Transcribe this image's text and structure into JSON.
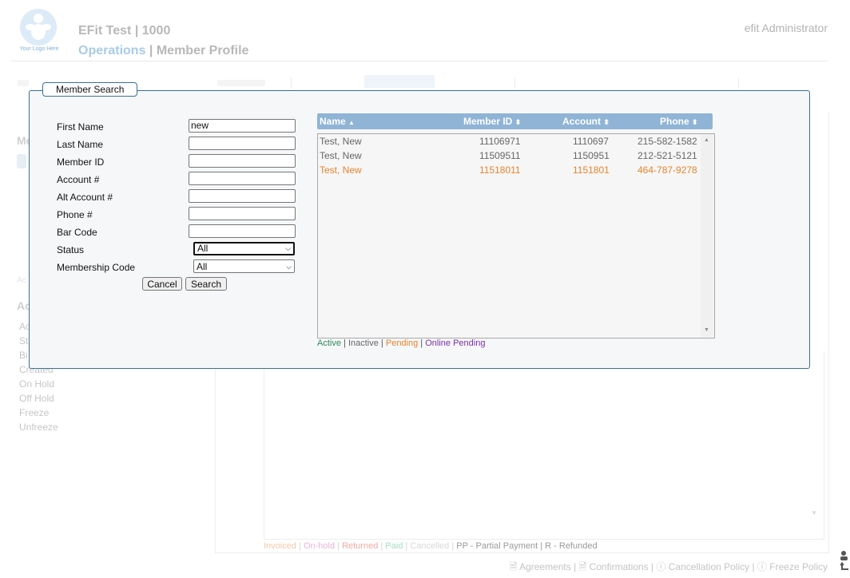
{
  "header": {
    "logo_text": "Your Logo Here",
    "company": "EFit Test | 1000",
    "crumb_section": "Operations",
    "crumb_sep": " | ",
    "crumb_page": "Member Profile",
    "user": "efit Administrator"
  },
  "background": {
    "member_heading": "Me",
    "account_small": "Ac",
    "account_heading": "Ac",
    "side_items": [
      "Ac",
      "St",
      "Bi",
      "Created",
      "On Hold",
      "Off Hold",
      "Freeze",
      "Unfreeze"
    ],
    "billing_legend": [
      {
        "text": "Invoiced",
        "color": "#f5c9a8"
      },
      {
        "text": "On-hold",
        "color": "#e8b3d9"
      },
      {
        "text": "Returned",
        "color": "#f2a9a0"
      },
      {
        "text": "Paid",
        "color": "#a8dcc0"
      },
      {
        "text": "Cancelled",
        "color": "#d8d8d8"
      },
      {
        "text": "PP - Partial Payment",
        "color": "#9a9a9a"
      },
      {
        "text": "R - Refunded",
        "color": "#9a9a9a"
      }
    ],
    "footer_links": [
      "Agreements",
      "Confirmations",
      "Cancellation Policy",
      "Freeze Policy"
    ]
  },
  "modal": {
    "title": "Member Search",
    "fields": {
      "first_name": {
        "label": "First Name",
        "value": "new"
      },
      "last_name": {
        "label": "Last Name",
        "value": ""
      },
      "member_id": {
        "label": "Member ID",
        "value": ""
      },
      "account": {
        "label": "Account #",
        "value": ""
      },
      "alt_account": {
        "label": "Alt Account #",
        "value": ""
      },
      "phone": {
        "label": "Phone #",
        "value": ""
      },
      "bar_code": {
        "label": "Bar Code",
        "value": ""
      },
      "status": {
        "label": "Status",
        "value": "All"
      },
      "membership_code": {
        "label": "Membership Code",
        "value": "All"
      }
    },
    "cancel_label": "Cancel",
    "search_label": "Search",
    "results": {
      "columns": [
        "Name",
        "Member ID",
        "Account",
        "Phone"
      ],
      "rows": [
        {
          "name": "Test, New",
          "member_id": "11106971",
          "account": "1110697",
          "phone": "215-582-1582",
          "status": "inactive"
        },
        {
          "name": "Test, New",
          "member_id": "11509511",
          "account": "1150951",
          "phone": "212-521-5121",
          "status": "inactive"
        },
        {
          "name": "Test, New",
          "member_id": "11518011",
          "account": "1151801",
          "phone": "464-787-9278",
          "status": "pending"
        }
      ]
    },
    "status_legend": [
      {
        "text": "Active",
        "color": "#2e8b57"
      },
      {
        "text": "Inactive",
        "color": "#666666"
      },
      {
        "text": "Pending",
        "color": "#e8832a"
      },
      {
        "text": "Online Pending",
        "color": "#7b2fa8"
      }
    ]
  },
  "colors": {
    "header_bar": "#8fb4d6",
    "modal_border": "#3a6f96",
    "inactive_text": "#666666",
    "pending_text": "#e8832a"
  }
}
